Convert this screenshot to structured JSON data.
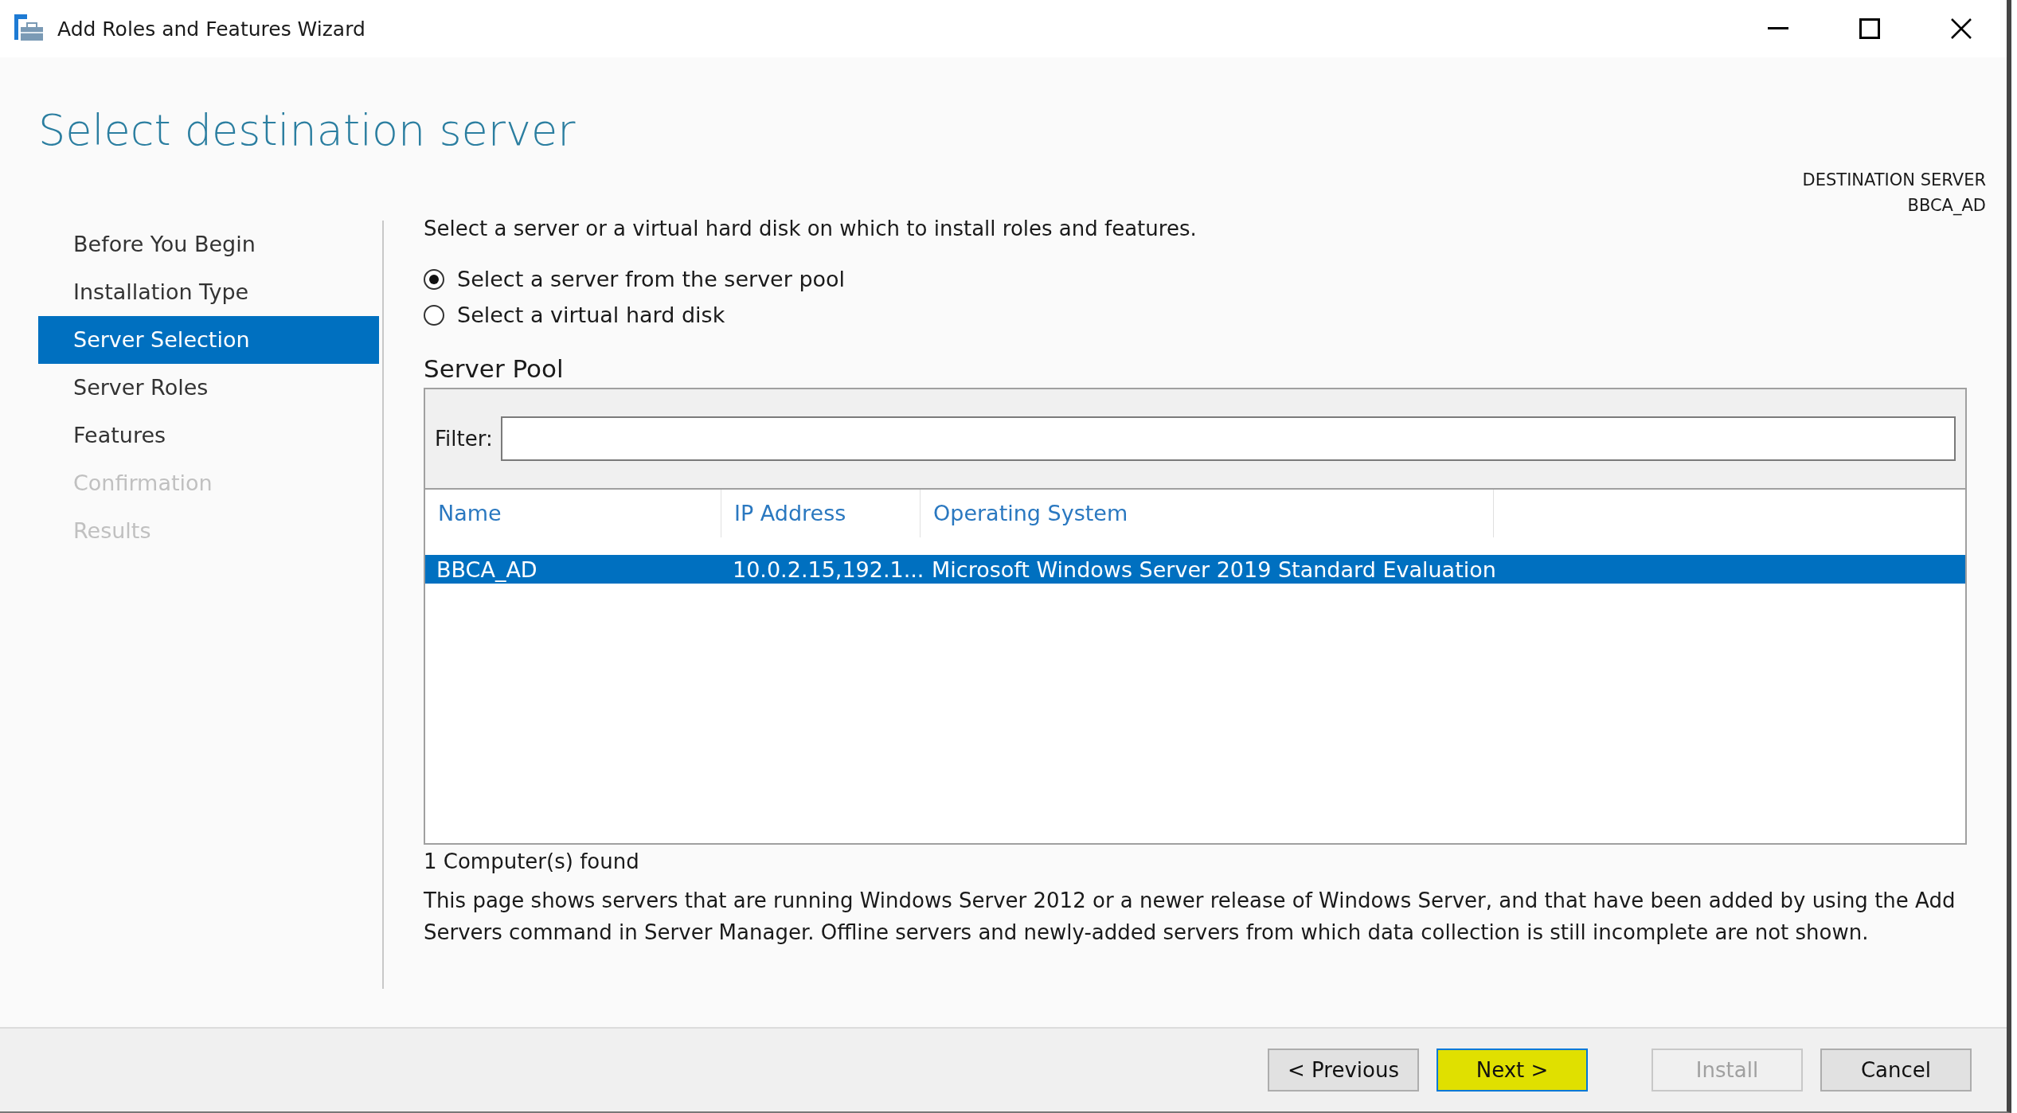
{
  "window": {
    "title": "Add Roles and Features Wizard"
  },
  "page_title": "Select destination server",
  "destination": {
    "label": "DESTINATION SERVER",
    "server": "BBCA_AD"
  },
  "steps": [
    {
      "label": "Before You Begin",
      "selected": false,
      "disabled": false
    },
    {
      "label": "Installation Type",
      "selected": false,
      "disabled": false
    },
    {
      "label": "Server Selection",
      "selected": true,
      "disabled": false
    },
    {
      "label": "Server Roles",
      "selected": false,
      "disabled": false
    },
    {
      "label": "Features",
      "selected": false,
      "disabled": false
    },
    {
      "label": "Confirmation",
      "selected": false,
      "disabled": true
    },
    {
      "label": "Results",
      "selected": false,
      "disabled": true
    }
  ],
  "instruction": "Select a server or a virtual hard disk on which to install roles and features.",
  "options": [
    {
      "label": "Select a server from the server pool",
      "selected": true
    },
    {
      "label": "Select a virtual hard disk",
      "selected": false
    }
  ],
  "server_pool": {
    "title": "Server Pool",
    "filter_label": "Filter:",
    "columns": [
      "Name",
      "IP Address",
      "Operating System"
    ],
    "rows": [
      {
        "cells": [
          "BBCA_AD",
          "10.0.2.15,192.1...",
          "Microsoft Windows Server 2019 Standard Evaluation"
        ],
        "selected": true
      }
    ],
    "count": "1 Computer(s) found"
  },
  "note": "This page shows servers that are running Windows Server 2012 or a newer release of Windows Server, and that have been added by using the Add Servers command in Server Manager. Offline servers and newly-added servers from which data collection is still incomplete are not shown.",
  "buttons": [
    {
      "label": "< Previous",
      "disabled": false,
      "highlighted": false
    },
    {
      "label": "Next >",
      "disabled": false,
      "highlighted": true
    },
    {
      "label": "Install",
      "disabled": true,
      "highlighted": false
    },
    {
      "label": "Cancel",
      "disabled": false,
      "highlighted": false
    }
  ]
}
